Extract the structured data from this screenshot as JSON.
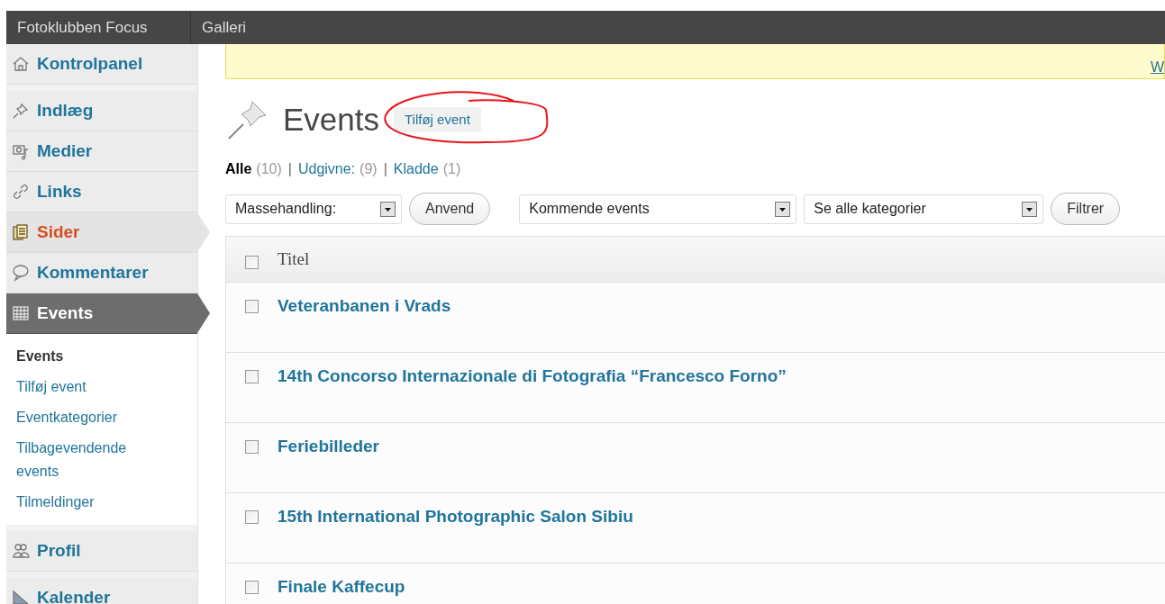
{
  "top_bar": {
    "items": [
      "Fotoklubben Focus",
      "Galleri"
    ]
  },
  "sidebar": {
    "items": [
      {
        "label": "Kontrolpanel",
        "selected": false,
        "hovered": false
      },
      {
        "label": "Indlæg",
        "selected": false,
        "hovered": false
      },
      {
        "label": "Medier",
        "selected": false,
        "hovered": false
      },
      {
        "label": "Links",
        "selected": false,
        "hovered": false
      },
      {
        "label": "Sider",
        "selected": false,
        "hovered": true
      },
      {
        "label": "Kommentarer",
        "selected": false,
        "hovered": false
      },
      {
        "label": "Events",
        "selected": true,
        "hovered": false,
        "children": [
          {
            "label": "Events",
            "selected": true
          },
          {
            "label": "Tilføj event",
            "selected": false
          },
          {
            "label": "Eventkategorier",
            "selected": false
          },
          {
            "label": "Tilbagevendende events",
            "selected": false
          },
          {
            "label": "Tilmeldinger",
            "selected": false
          }
        ]
      },
      {
        "label": "Profil",
        "selected": false,
        "hovered": false
      },
      {
        "label": "Kalender",
        "selected": false,
        "hovered": false
      }
    ]
  },
  "notice": {
    "link": "W"
  },
  "page": {
    "title": "Events",
    "add_button": "Tilføj event",
    "annotation": true
  },
  "filters": [
    {
      "label": "Alle",
      "count": "(10)",
      "selected": true
    },
    {
      "separator": "|",
      "label": "Udgivne:",
      "count": "(9)",
      "selected": false
    },
    {
      "separator": "|",
      "label": "Kladde",
      "count": "(1)",
      "selected": false
    }
  ],
  "toolbar": {
    "bulk_action": "Massehandling:",
    "apply": "Anvend",
    "period": "Kommende events",
    "category": "Se alle kategorier",
    "filter": "Filtrer"
  },
  "table": {
    "header": {
      "title": "Titel",
      "checked": false
    },
    "rows": [
      {
        "title": "Veteranbanen i Vrads",
        "checked": false
      },
      {
        "title": "14th Concorso Internazionale di Fotografia “Francesco Forno”",
        "checked": false
      },
      {
        "title": "Feriebilleder",
        "checked": false
      },
      {
        "title": "15th International Photographic Salon Sibiu",
        "checked": false
      },
      {
        "title": "Finale Kaffecup",
        "checked": false
      }
    ]
  }
}
